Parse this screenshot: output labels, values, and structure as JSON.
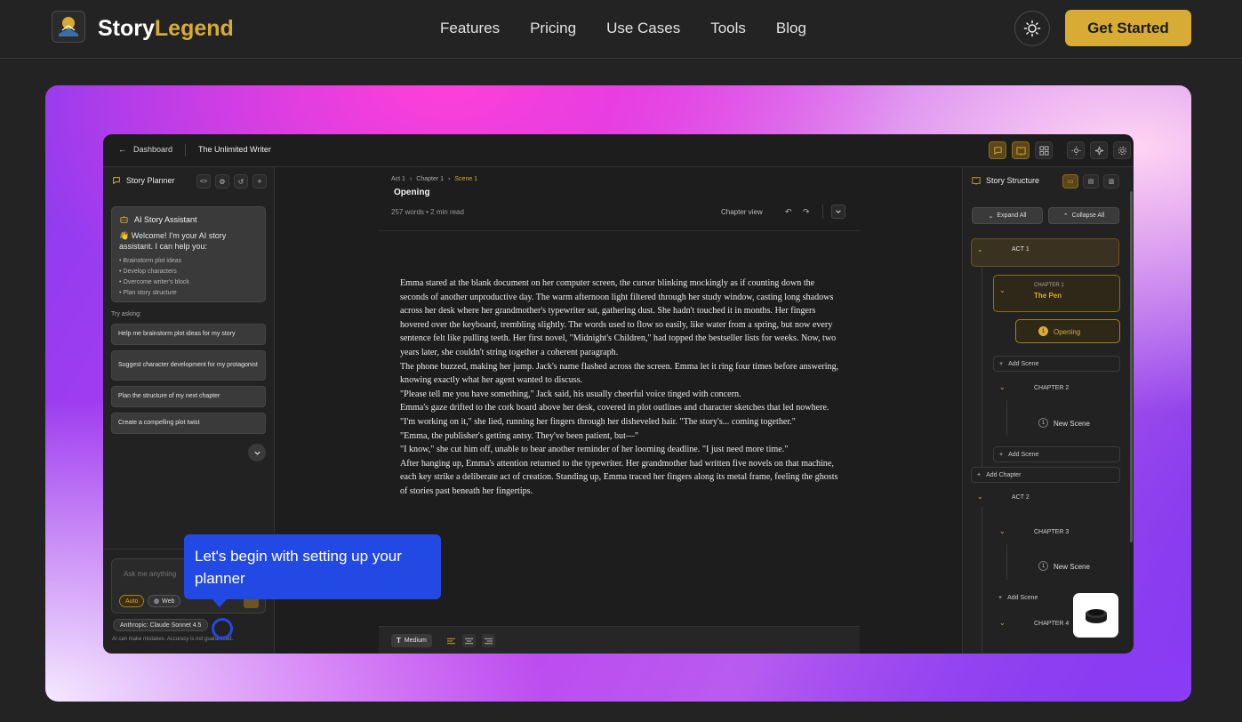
{
  "site": {
    "brand_part1": "Story",
    "brand_part2": "Legend",
    "nav": [
      "Features",
      "Pricing",
      "Use Cases",
      "Tools",
      "Blog"
    ],
    "cta": "Get Started",
    "colors": {
      "accent": "#d8ac34",
      "background": "#232323",
      "tooltip": "#2349e4"
    }
  },
  "app": {
    "back_label": "Dashboard",
    "document_title": "The Unlimited Writer",
    "left": {
      "title": "Story Planner",
      "assistant_title": "AI Story Assistant",
      "assistant_intro": "👋 Welcome! I'm your AI story assistant. I can help you:",
      "assistant_items": [
        "• Brainstorm plot ideas",
        "• Develop characters",
        "• Overcome writer's block",
        "• Plan story structure"
      ],
      "try_asking": "Try asking:",
      "suggestions": [
        "Help me brainstorm plot ideas for my story",
        "Suggest character development for my protagonist",
        "Plan the structure of my next chapter",
        "Create a compelling plot twist"
      ],
      "input_placeholder": "Ask me anything",
      "chip_auto": "Auto",
      "chip_web": "Web",
      "model": "Anthropic: Claude Sonnet 4.5",
      "disclaimer": "AI can make mistakes. Accuracy is not guaranteed."
    },
    "editor": {
      "crumb_act": "Act 1",
      "crumb_chapter": "Chapter 1",
      "crumb_scene": "Scene 1",
      "scene_title": "Opening",
      "meta": "257 words • 2 min read",
      "view_label": "Chapter view",
      "paragraphs": [
        "Emma stared at the blank document on her computer screen, the cursor blinking mockingly as if counting down the seconds of another unproductive day. The warm afternoon light filtered through her study window, casting long shadows across her desk where her grandmother's typewriter sat, gathering dust. She hadn't touched it in months. Her fingers hovered over the keyboard, trembling slightly. The words used to flow so easily, like water from a spring, but now every sentence felt like pulling teeth. Her first novel, \"Midnight's Children,\" had topped the bestseller lists for weeks. Now, two years later, she couldn't string together a coherent paragraph.",
        "The phone buzzed, making her jump. Jack's name flashed across the screen. Emma let it ring four times before answering, knowing exactly what her agent wanted to discuss.",
        "\"Please tell me you have something,\" Jack said, his usually cheerful voice tinged with concern.",
        "Emma's gaze drifted to the cork board above her desk, covered in plot outlines and character sketches that led nowhere. \"I'm working on it,\" she lied, running her fingers through her disheveled hair. \"The story's... coming together.\"",
        "\"Emma, the publisher's getting antsy. They've been patient, but—\"",
        "\"I know,\" she cut him off, unable to bear another reminder of her looming deadline. \"I just need more time.\"",
        "After hanging up, Emma's attention returned to the typewriter. Her grandmother had written five novels on that machine, each key strike a deliberate act of creation. Standing up, Emma traced her fingers along its metal frame, feeling the ghosts of stories past beneath her fingertips."
      ],
      "format_size": "Medium"
    },
    "right": {
      "title": "Story Structure",
      "expand_all": "Expand All",
      "collapse_all": "Collapse All",
      "act1": "ACT 1",
      "ch1_label": "CHAPTER 1",
      "ch1_title": "The Pen",
      "opening": "Opening",
      "opening_num": "1",
      "add_scene": "Add Scene",
      "ch2": "CHAPTER 2",
      "new_scene": "New Scene",
      "new_scene_num": "1",
      "add_chapter": "Add Chapter",
      "act2": "ACT 2",
      "ch3": "CHAPTER 3",
      "ch4": "CHAPTER 4"
    }
  },
  "tooltip": {
    "text": "Let's begin with setting up your planner"
  }
}
